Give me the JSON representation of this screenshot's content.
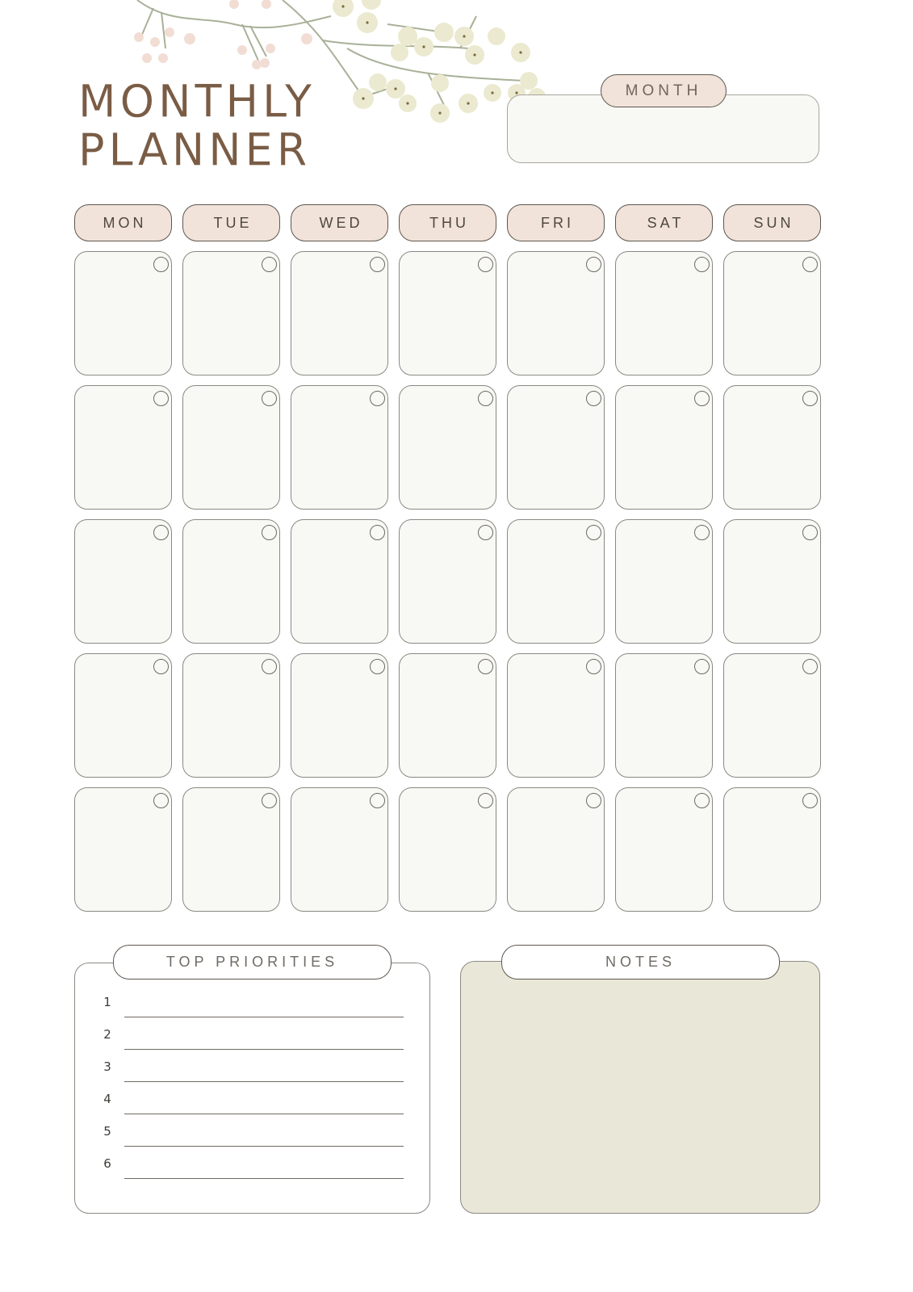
{
  "header": {
    "title_line1": "MONTHLY",
    "title_line2": "PLANNER",
    "decoration": "floral-branch-icon"
  },
  "month": {
    "label": "MONTH",
    "value": ""
  },
  "calendar": {
    "weekdays": [
      "MON",
      "TUE",
      "WED",
      "THU",
      "FRI",
      "SAT",
      "SUN"
    ],
    "rows": 5,
    "columns": 7
  },
  "priorities": {
    "label": "TOP PRIORITIES",
    "items": [
      {
        "number": "1",
        "text": ""
      },
      {
        "number": "2",
        "text": ""
      },
      {
        "number": "3",
        "text": ""
      },
      {
        "number": "4",
        "text": ""
      },
      {
        "number": "5",
        "text": ""
      },
      {
        "number": "6",
        "text": ""
      }
    ]
  },
  "notes": {
    "label": "NOTES",
    "value": ""
  },
  "colors": {
    "title": "#7a5c45",
    "tab_fill": "#f1e3da",
    "cell_fill": "#f8f8f4",
    "notes_fill": "#e9e7d8",
    "outline": "#5e574f"
  }
}
